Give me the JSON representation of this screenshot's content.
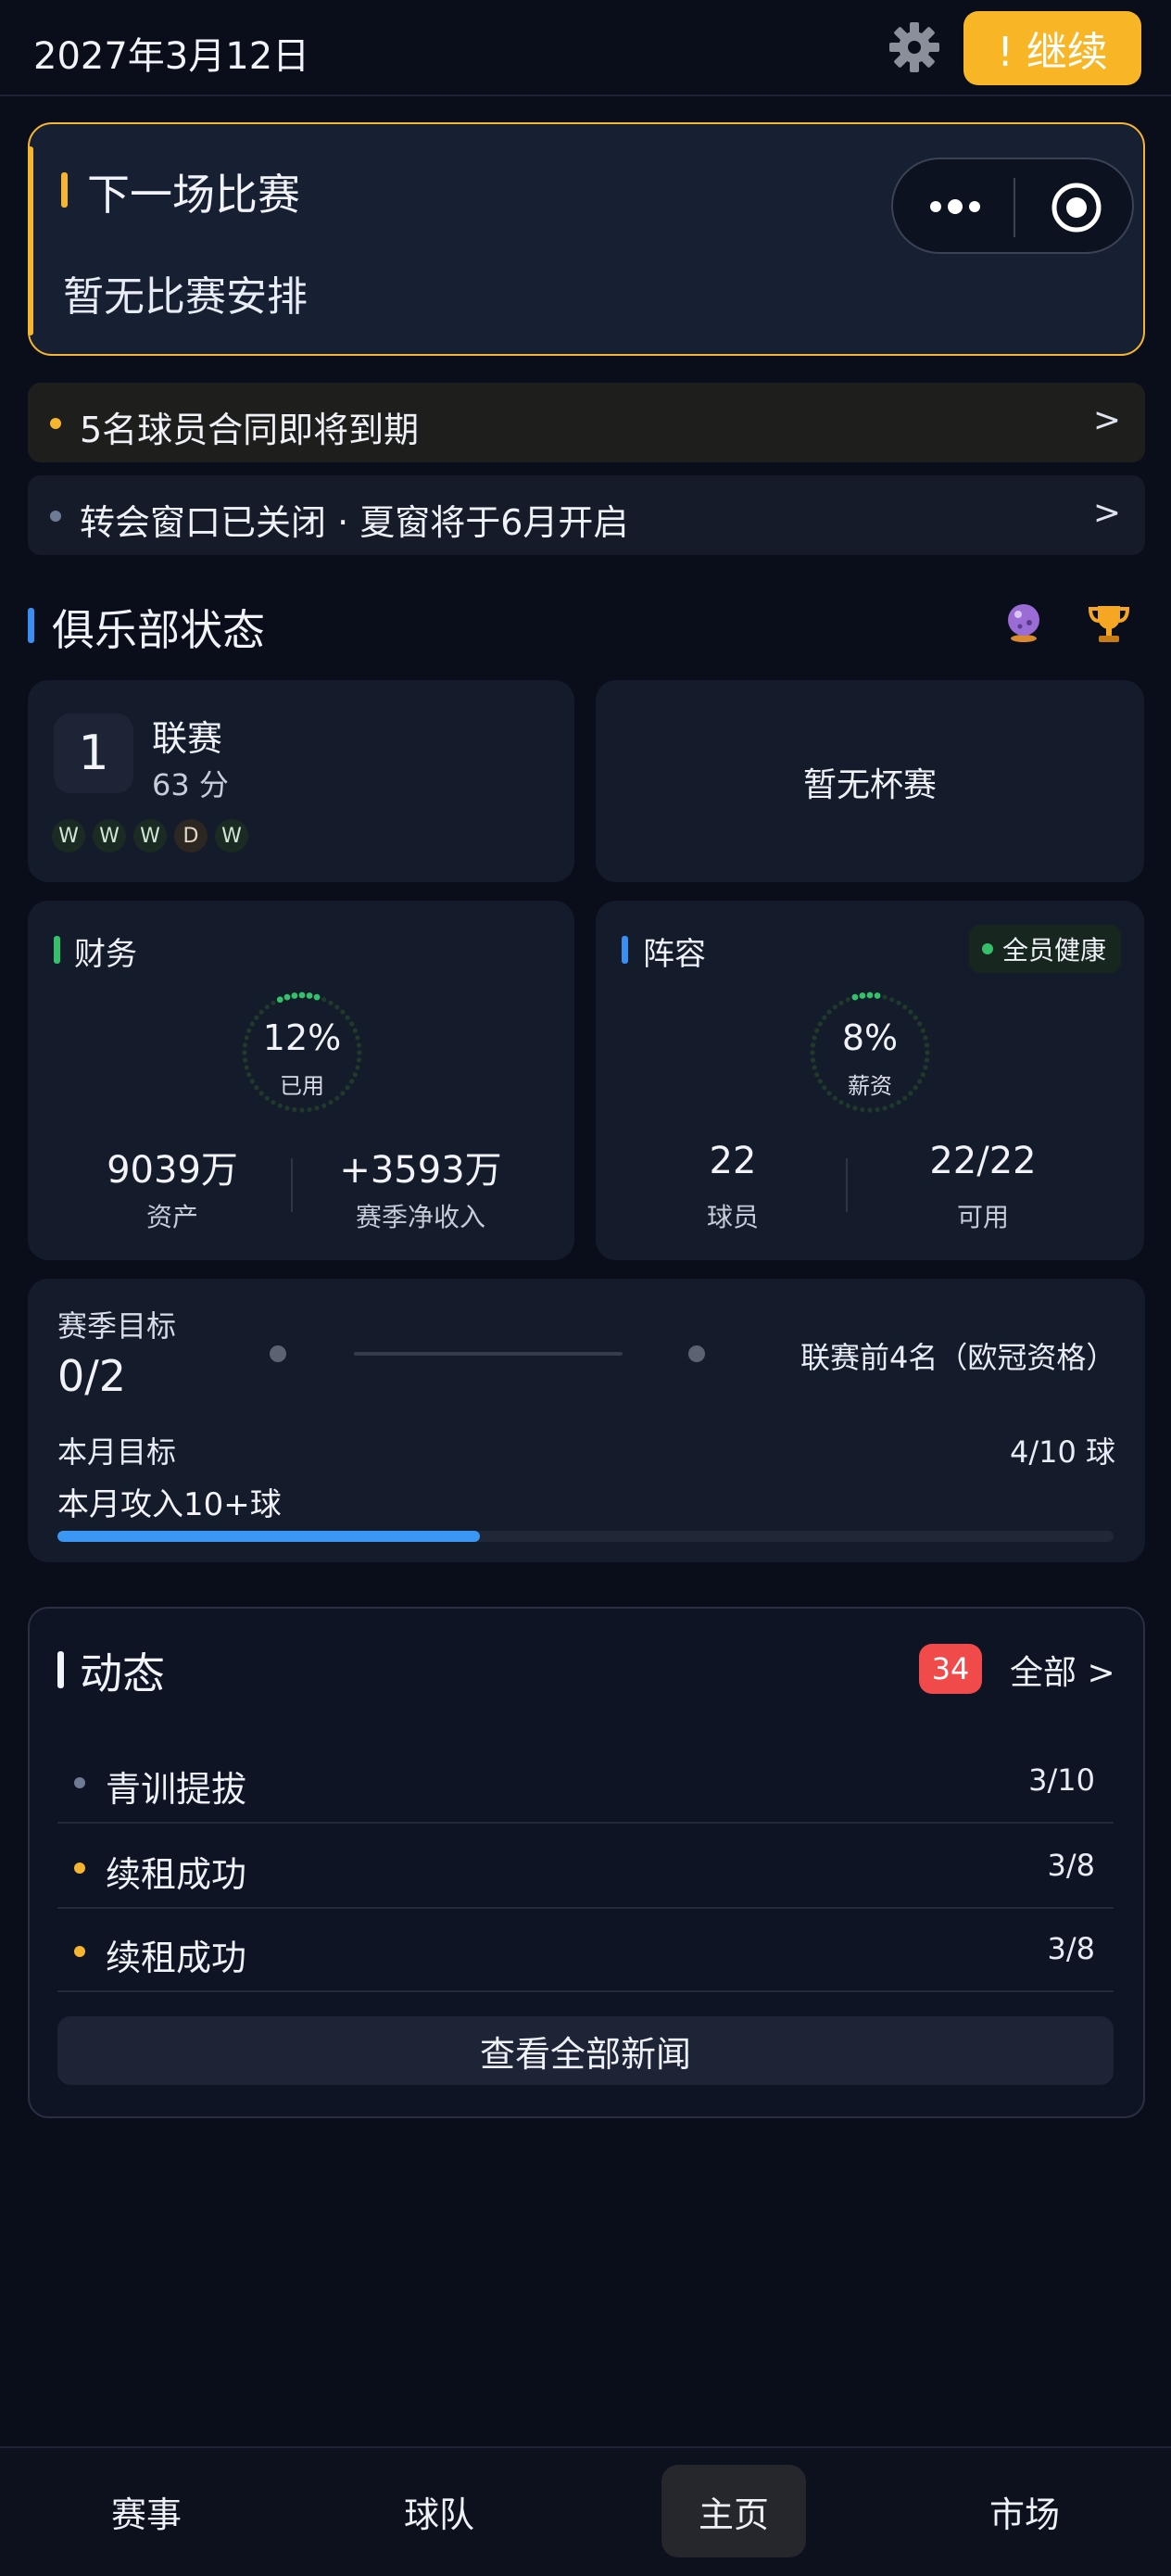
{
  "header": {
    "date": "2027年3月12日",
    "continue_label": "! 继续"
  },
  "next_match": {
    "title": "下一场比赛",
    "subtitle": "暂无比赛安排"
  },
  "alerts": [
    {
      "text": "5名球员合同即将到期",
      "arrow": ">",
      "dot_color": "#f6b531"
    },
    {
      "text": "转会窗口已关闭 · 夏窗将于6月开启",
      "arrow": ">",
      "dot_color": "#6f7a94"
    }
  ],
  "club_status": {
    "title": "俱乐部状态",
    "league": {
      "rank": "1",
      "label": "联赛",
      "points": "63 分",
      "form": [
        "W",
        "W",
        "W",
        "D",
        "W"
      ]
    },
    "cup": {
      "text": "暂无杯赛"
    },
    "finance": {
      "title": "财务",
      "gauge_pct": "12%",
      "gauge_value": 0.12,
      "gauge_label": "已用",
      "assets_value": "9039万",
      "assets_label": "资产",
      "income_value": "+3593万",
      "income_label": "赛季净收入"
    },
    "squad": {
      "title": "阵容",
      "health": "全员健康",
      "gauge_pct": "8%",
      "gauge_value": 0.08,
      "gauge_label": "薪资",
      "players_value": "22",
      "players_label": "球员",
      "available_value": "22/22",
      "available_label": "可用"
    }
  },
  "goals": {
    "season_label": "赛季目标",
    "season_value": "0/2",
    "season_target": "联赛前4名（欧冠资格）",
    "month_label": "本月目标",
    "month_count": "4/10 球",
    "month_goal": "本月攻入10+球",
    "month_progress": 0.4
  },
  "news": {
    "title": "动态",
    "badge": "34",
    "all_label": "全部 >",
    "items": [
      {
        "text": "青训提拔",
        "count": "3/10",
        "dot_color": "#6f7a94"
      },
      {
        "text": "续租成功",
        "count": "3/8",
        "dot_color": "#f6b531"
      },
      {
        "text": "续租成功",
        "count": "3/8",
        "dot_color": "#f6b531"
      }
    ],
    "view_all": "查看全部新闻"
  },
  "nav": [
    {
      "label": "赛事"
    },
    {
      "label": "球队"
    },
    {
      "label": "主页",
      "active": true
    },
    {
      "label": "市场"
    }
  ],
  "colors": {
    "accent": "#f6b531",
    "blue": "#3b96f4",
    "green": "#35c06a",
    "red": "#f04a4a"
  }
}
